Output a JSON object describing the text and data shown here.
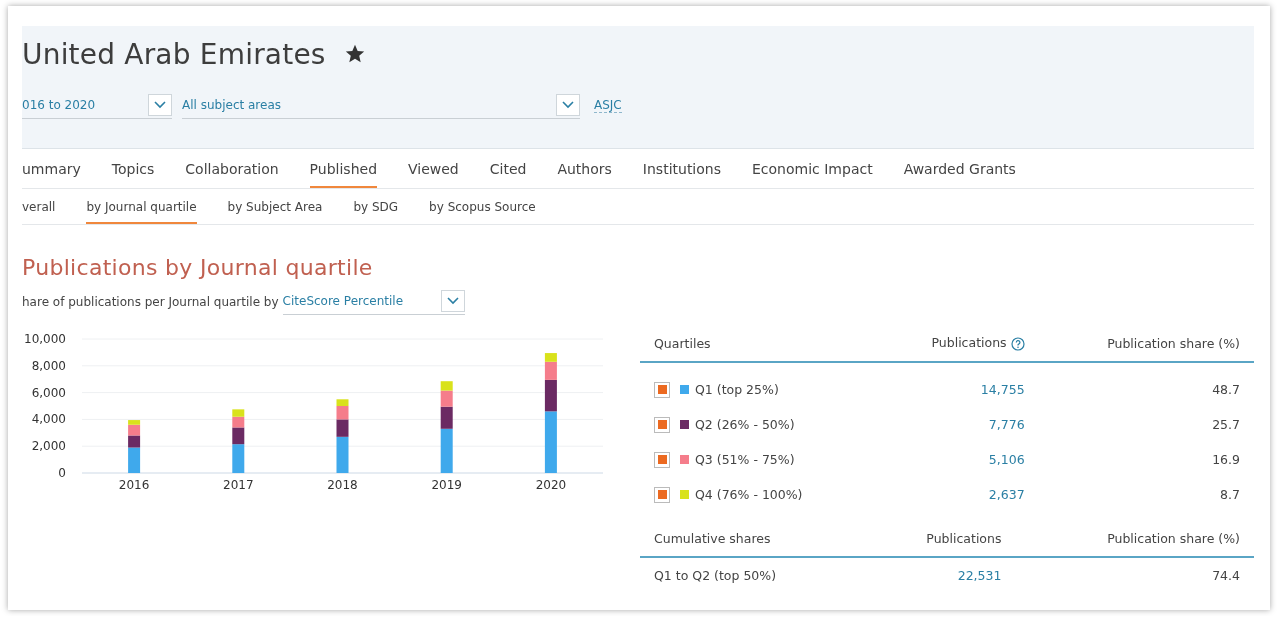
{
  "header": {
    "title": "United Arab Emirates",
    "starred": true,
    "period": {
      "value": "016 to 2020"
    },
    "subject": {
      "value": "All subject areas"
    },
    "classification_link": "ASJC"
  },
  "tabs": [
    {
      "label": "ummary",
      "selected": false
    },
    {
      "label": "Topics",
      "selected": false
    },
    {
      "label": "Collaboration",
      "selected": false
    },
    {
      "label": "Published",
      "selected": true
    },
    {
      "label": "Viewed",
      "selected": false
    },
    {
      "label": "Cited",
      "selected": false
    },
    {
      "label": "Authors",
      "selected": false
    },
    {
      "label": "Institutions",
      "selected": false
    },
    {
      "label": "Economic Impact",
      "selected": false
    },
    {
      "label": "Awarded Grants",
      "selected": false
    }
  ],
  "subtabs": [
    {
      "label": "verall",
      "selected": false
    },
    {
      "label": "by Journal quartile",
      "selected": true
    },
    {
      "label": "by Subject Area",
      "selected": false
    },
    {
      "label": "by SDG",
      "selected": false
    },
    {
      "label": "by Scopus Source",
      "selected": false
    }
  ],
  "section": {
    "title": "Publications by Journal quartile",
    "subtitle": "hare of publications per Journal quartile by",
    "metric": {
      "value": "CiteScore Percentile"
    }
  },
  "chart_data": {
    "type": "bar",
    "stacked": true,
    "grid": true,
    "categories": [
      "2016",
      "2017",
      "2018",
      "2019",
      "2020"
    ],
    "ylim": [
      0,
      10000
    ],
    "yticks": [
      {
        "value": 0,
        "label": "0"
      },
      {
        "value": 2000,
        "label": "2,000"
      },
      {
        "value": 4000,
        "label": "4,000"
      },
      {
        "value": 6000,
        "label": "6,000"
      },
      {
        "value": 8000,
        "label": "8,000"
      },
      {
        "value": 10000,
        "label": "10,000"
      }
    ],
    "series": [
      {
        "name": "Q1 (top 25%)",
        "color": "#3fa9ec",
        "values": [
          1900,
          2150,
          2700,
          3300,
          4600
        ]
      },
      {
        "name": "Q2 (26% - 50%)",
        "color": "#6b2a63",
        "values": [
          900,
          1250,
          1300,
          1650,
          2350
        ]
      },
      {
        "name": "Q3 (51% - 75%)",
        "color": "#f57d8b",
        "values": [
          800,
          800,
          1000,
          1200,
          1350
        ]
      },
      {
        "name": "Q4 (76% - 100%)",
        "color": "#d9e21b",
        "values": [
          350,
          550,
          500,
          700,
          650
        ]
      }
    ]
  },
  "quartile_table": {
    "columns": [
      "Quartiles",
      "Publications",
      "Publication share (%)"
    ],
    "rows": [
      {
        "checked": true,
        "publications": "14,755",
        "share": "48.7"
      },
      {
        "checked": true,
        "publications": "7,776",
        "share": "25.7"
      },
      {
        "checked": true,
        "publications": "5,106",
        "share": "16.9"
      },
      {
        "checked": true,
        "publications": "2,637",
        "share": "8.7"
      }
    ]
  },
  "cumulative_table": {
    "columns": [
      "Cumulative shares",
      "Publications",
      "Publication share (%)"
    ],
    "rows": [
      {
        "label": "Q1 to Q2 (top 50%)",
        "publications": "22,531",
        "share": "74.4"
      }
    ]
  }
}
